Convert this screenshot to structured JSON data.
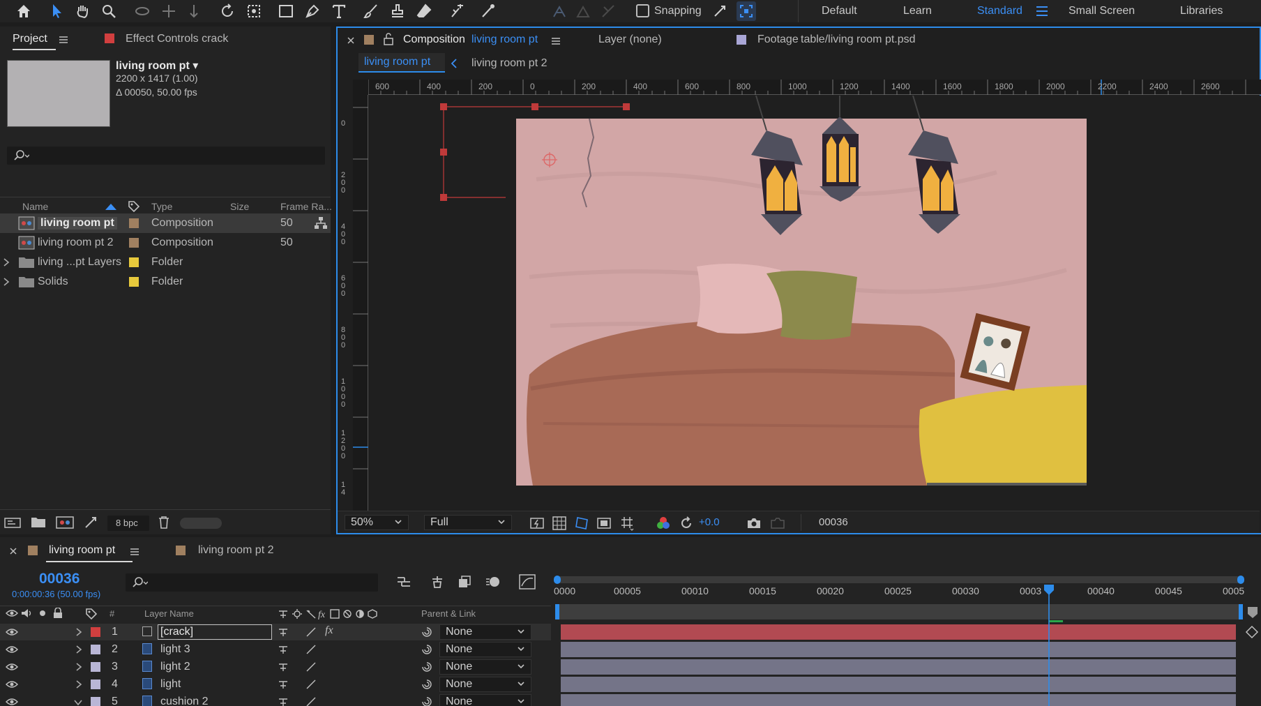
{
  "toolbar": {
    "snapping_label": "Snapping",
    "workspaces": [
      "Default",
      "Learn",
      "Standard",
      "Small Screen",
      "Libraries"
    ],
    "active_workspace": "Standard"
  },
  "project_panel": {
    "tab_label": "Project",
    "effect_controls_label": "Effect Controls crack",
    "selected_name": "living room pt ▾",
    "selected_dims": "2200 x 1417 (1.00)",
    "selected_duration": "Δ 00050, 50.00 fps",
    "search_placeholder": "",
    "columns": {
      "name": "Name",
      "type": "Type",
      "size": "Size",
      "frame_rate": "Frame Ra..."
    },
    "items": [
      {
        "name": "living room pt",
        "type": "Composition",
        "frame_rate": "50",
        "color": "#a08060"
      },
      {
        "name": "living room pt 2",
        "type": "Composition",
        "frame_rate": "50",
        "color": "#a08060"
      },
      {
        "name": "living ...pt Layers",
        "type": "Folder",
        "frame_rate": "",
        "color": "#e7c93c"
      },
      {
        "name": "Solids",
        "type": "Folder",
        "frame_rate": "",
        "color": "#e7c93c"
      }
    ],
    "bpc_label": "8 bpc"
  },
  "comp_panel": {
    "comp_tab_prefix": "Composition",
    "comp_tab_name": "living room pt",
    "layer_tab": "Layer (none)",
    "footage_tab_prefix": "Footage",
    "footage_tab_name": "table/living room pt.psd",
    "subtabs": [
      "living room pt",
      "living room pt 2"
    ],
    "ruler_h": [
      "600",
      "400",
      "200",
      "0",
      "200",
      "400",
      "600",
      "800",
      "1000",
      "1200",
      "1400",
      "1600",
      "1800",
      "2000",
      "2200",
      "2400",
      "2600"
    ],
    "ruler_v": [
      "0",
      "2\n0\n0",
      "4\n0\n0",
      "6\n0\n0",
      "8\n0\n0",
      "1\n0\n0\n0",
      "1\n2\n0\n0",
      "1\n4"
    ],
    "zoom": "50%",
    "resolution": "Full",
    "exposure": "+0.0",
    "current_frame": "00036"
  },
  "timeline": {
    "comp_tab": "living room pt",
    "comp_tab_2": "living room pt 2",
    "timecode": "00036",
    "timecode_sub": "0:00:00:36 (50.00 fps)",
    "headers": {
      "num": "#",
      "layer_name": "Layer Name",
      "parent": "Parent & Link"
    },
    "ruler_ticks": [
      "0000",
      "00005",
      "00010",
      "00015",
      "00020",
      "00025",
      "00030",
      "0003",
      "00040",
      "00045",
      "0005"
    ],
    "layers": [
      {
        "num": "1",
        "name": "[crack]",
        "label_color": "#d13f3f",
        "parent": "None",
        "bar_color": "#b24a52"
      },
      {
        "num": "2",
        "name": "light 3",
        "label_color": "#b9b6d6",
        "parent": "None",
        "bar_color": "#747488"
      },
      {
        "num": "3",
        "name": "light 2",
        "label_color": "#b9b6d6",
        "parent": "None",
        "bar_color": "#747488"
      },
      {
        "num": "4",
        "name": "light",
        "label_color": "#b9b6d6",
        "parent": "None",
        "bar_color": "#747488"
      },
      {
        "num": "5",
        "name": "cushion 2",
        "label_color": "#b9b6d6",
        "parent": "None",
        "bar_color": "#747488"
      }
    ]
  },
  "colors": {
    "accent": "#2d8ceb",
    "comp_label": "#a08060",
    "effect_label": "#d13f3f",
    "footage_label": "#a9a6d6"
  }
}
